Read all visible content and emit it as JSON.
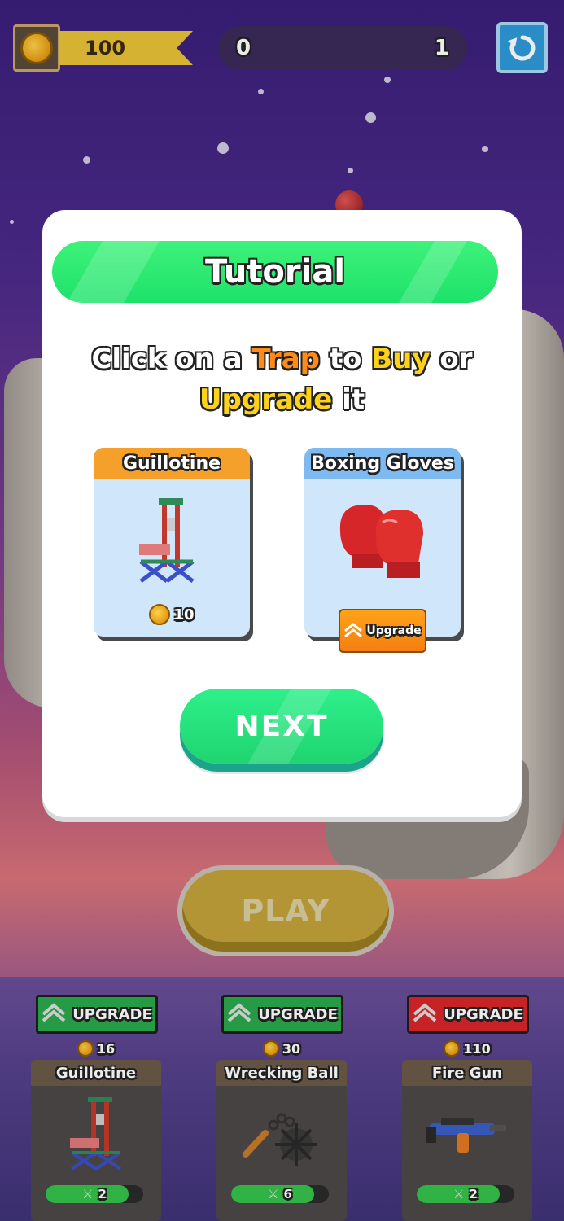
{
  "hud": {
    "coins": "100",
    "progress_start": "0",
    "progress_end": "1",
    "coin_icon": "coin-icon",
    "restart_icon": "restart-icon"
  },
  "tutorial": {
    "title": "Tutorial",
    "instruction": {
      "part1": "Click on a ",
      "trap": "Trap",
      "part2": " to ",
      "buy": "Buy",
      "part3": " or",
      "upgrade": "Upgrade",
      "part4": " it"
    },
    "cards": [
      {
        "title": "Guillotine",
        "price": "10",
        "header_color": "#f4a02a"
      },
      {
        "title": "Boxing Gloves",
        "button_label": "Upgrade",
        "header_color": "#7ebaf0"
      }
    ],
    "next_label": "NEXT"
  },
  "play_label": "PLAY",
  "traps": [
    {
      "name": "Guillotine",
      "upgrade_label": "UPGRADE",
      "price": "16",
      "level": "2",
      "level_fill": 0.85,
      "button_color": "#2aa84a"
    },
    {
      "name": "Wrecking Ball",
      "upgrade_label": "UPGRADE",
      "price": "30",
      "level": "6",
      "level_fill": 0.85,
      "button_color": "#2aa84a"
    },
    {
      "name": "Fire Gun",
      "upgrade_label": "UPGRADE",
      "price": "110",
      "level": "2",
      "level_fill": 0.85,
      "button_color": "#d8262a"
    }
  ],
  "colors": {
    "accent_green": "#1de26a",
    "accent_orange": "#ff8a1a",
    "accent_yellow": "#ffd21a"
  }
}
